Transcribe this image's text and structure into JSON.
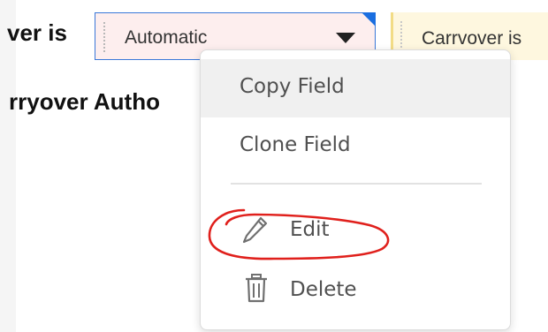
{
  "form": {
    "row_label": "ver is",
    "section_label": "rryover Autho",
    "select": {
      "value": "Automatic"
    },
    "text_field": {
      "value": "Carrvover is"
    }
  },
  "context_menu": {
    "items": [
      {
        "label": "Copy Field",
        "icon": ""
      },
      {
        "label": "Clone Field",
        "icon": ""
      },
      {
        "label": "Edit",
        "icon": "pencil-icon"
      },
      {
        "label": "Delete",
        "icon": "trash-icon"
      }
    ]
  },
  "colors": {
    "select_border": "#3a78d8",
    "select_background": "#fdeeee",
    "corner_flag": "#1b6fe0",
    "text_field_background": "#fef7df",
    "annotation": "#e0201c"
  }
}
